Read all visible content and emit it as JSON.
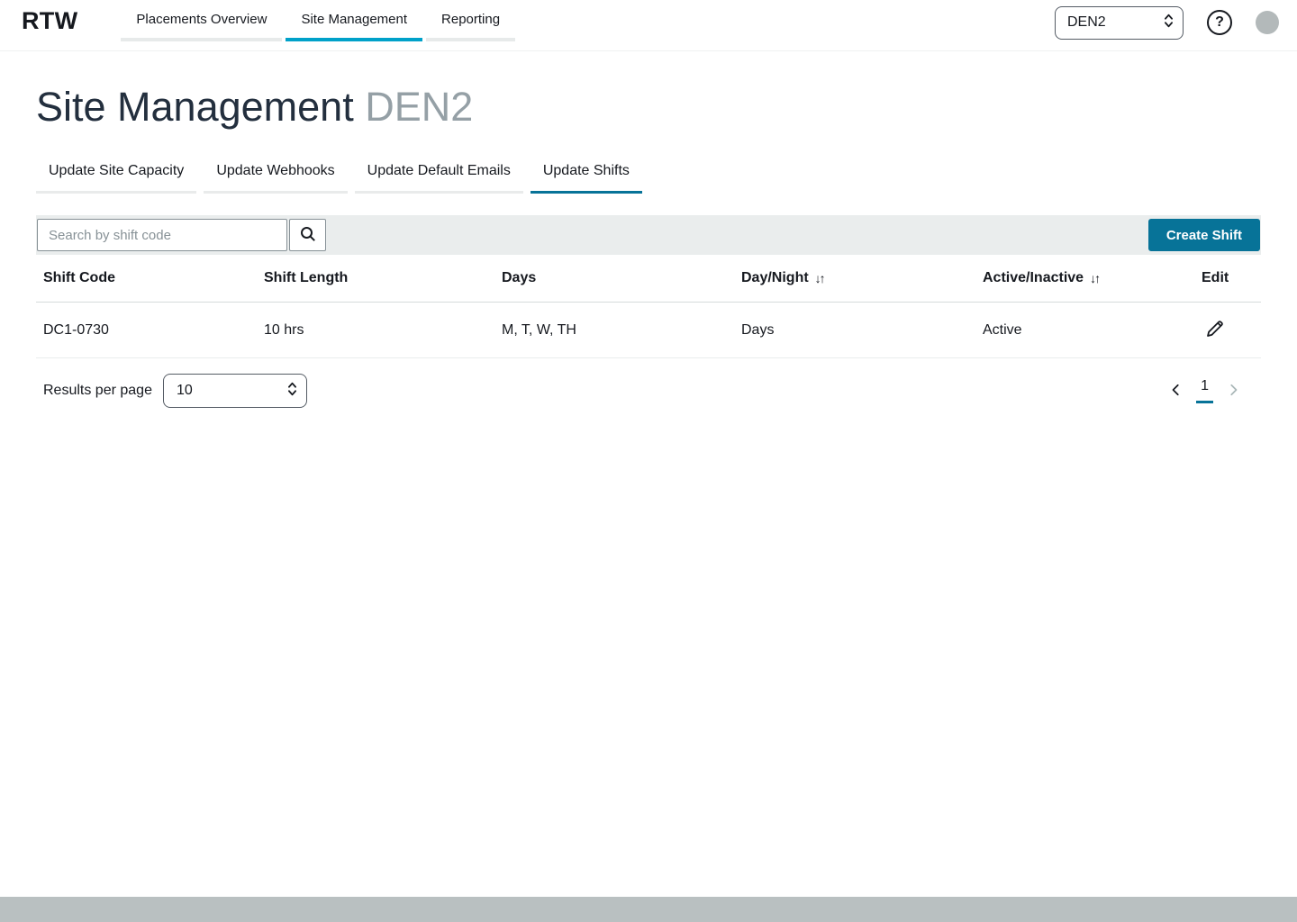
{
  "header": {
    "logo": "RTW",
    "nav": [
      {
        "label": "Placements Overview"
      },
      {
        "label": "Site Management"
      },
      {
        "label": "Reporting"
      }
    ],
    "site_select": {
      "value": "DEN2"
    },
    "help_glyph": "?"
  },
  "page": {
    "title": "Site Management",
    "site": "DEN2"
  },
  "tabs": [
    {
      "label": "Update Site Capacity"
    },
    {
      "label": "Update Webhooks"
    },
    {
      "label": "Update Default Emails"
    },
    {
      "label": "Update Shifts"
    }
  ],
  "toolbar": {
    "search_placeholder": "Search by shift code",
    "create_button": "Create Shift"
  },
  "table": {
    "columns": [
      "Shift Code",
      "Shift Length",
      "Days",
      "Day/Night",
      "Active/Inactive",
      "Edit"
    ],
    "sort_glyph": "↓↑",
    "rows": [
      {
        "shift_code": "DC1-0730",
        "shift_length": "10 hrs",
        "days": "M, T, W, TH",
        "day_night": "Days",
        "active_inactive": "Active"
      }
    ]
  },
  "pagination": {
    "results_per_page_label": "Results per page",
    "results_per_page_value": "10",
    "current_page": "1"
  },
  "colors": {
    "accent": "#077398",
    "nav_accent": "#00a1c9",
    "text": "#16191f",
    "muted": "#95a0a6",
    "border": "#879196",
    "light_border": "#eaeded",
    "toolbar_bg": "#eaeded",
    "footer_bg": "#b9c0c1"
  }
}
